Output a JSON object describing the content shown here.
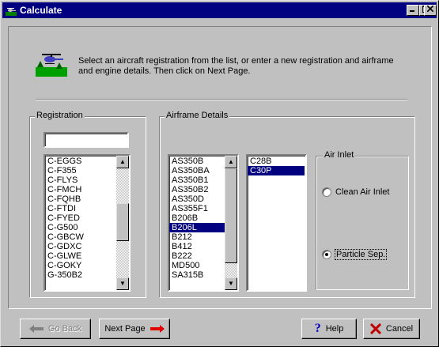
{
  "window": {
    "title": "Calculate"
  },
  "intro": {
    "text": "Select an aircraft registration from the list, or enter a new registration and airframe and  engine details.  Then click on Next Page."
  },
  "registration": {
    "legend": "Registration",
    "input_value": "",
    "items": [
      "C-EGGS",
      "C-F355",
      "C-FLYS",
      "C-FMCH",
      "C-FQHB",
      "C-FTDI",
      "C-FYED",
      "C-G500",
      "C-GBCW",
      "C-GDXC",
      "C-GLWE",
      "C-GOKY",
      "G-350B2"
    ]
  },
  "airframe": {
    "legend": "Airframe Details",
    "items": [
      "AS350B",
      "AS350BA",
      "AS350B1",
      "AS350B2",
      "AS350D",
      "AS355F1",
      "B206B",
      "B206L",
      "B212",
      "B412",
      "B222",
      "MD500",
      "SA315B"
    ],
    "selected": "B206L",
    "engines": [
      "C28B",
      "C30P"
    ],
    "engine_selected": "C30P"
  },
  "air_inlet": {
    "legend": "Air Inlet",
    "option1": "Clean Air Inlet",
    "option2": "Particle Sep.",
    "selected": "Particle Sep."
  },
  "buttons": {
    "back": "Go Back",
    "next": "Next Page",
    "help": "Help",
    "cancel": "Cancel"
  }
}
